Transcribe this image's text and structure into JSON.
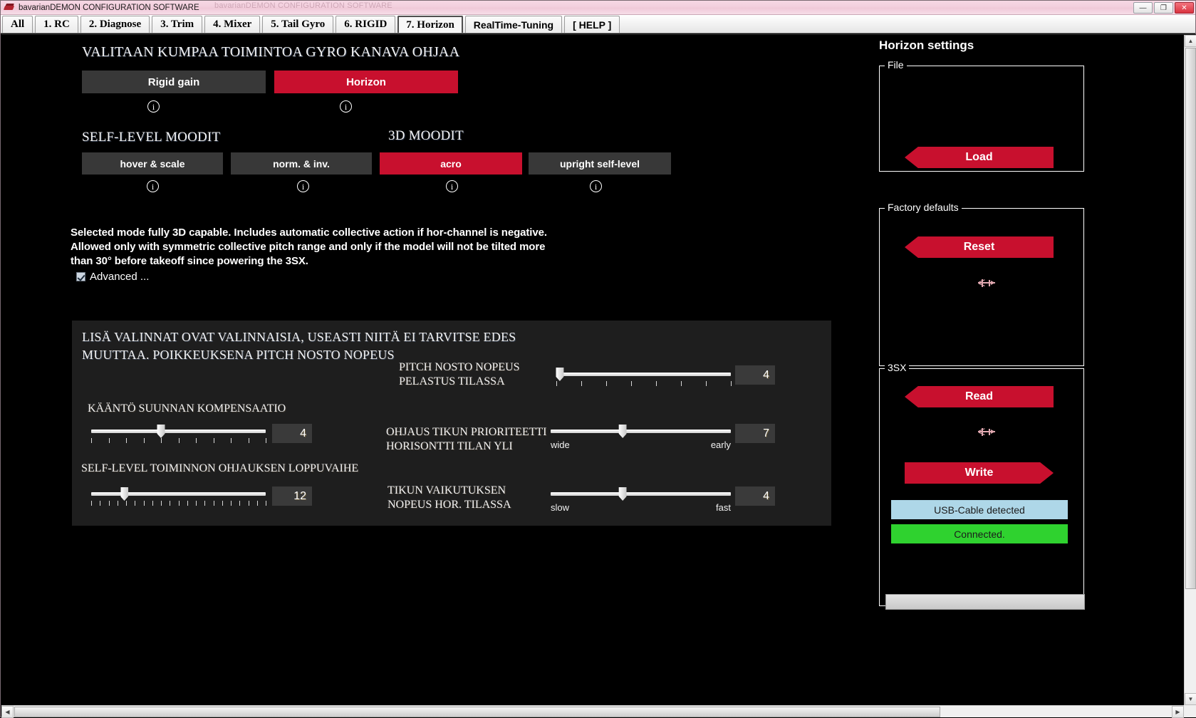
{
  "window": {
    "title": "bavarianDEMON CONFIGURATION SOFTWARE",
    "ghost_title": "bavarianDEMON CONFIGURATION SOFTWARE",
    "minimize": "—",
    "maximize": "❐",
    "close": "✕"
  },
  "tabs": [
    {
      "label": "All",
      "selected": false,
      "style": "serif"
    },
    {
      "label": "1. RC",
      "selected": false,
      "style": "serif"
    },
    {
      "label": "2. Diagnose",
      "selected": false,
      "style": "serif"
    },
    {
      "label": "3. Trim",
      "selected": false,
      "style": "serif"
    },
    {
      "label": "4. Mixer",
      "selected": false,
      "style": "serif"
    },
    {
      "label": "5. Tail Gyro",
      "selected": false,
      "style": "serif"
    },
    {
      "label": "6. RIGID",
      "selected": false,
      "style": "serif"
    },
    {
      "label": "7. Horizon",
      "selected": true,
      "style": "serif"
    },
    {
      "label": "RealTime-Tuning",
      "selected": false,
      "style": "sans"
    },
    {
      "label": "[ HELP ]",
      "selected": false,
      "style": "sans"
    }
  ],
  "main": {
    "gyro_channel_heading": "VALITAAN KUMPAA TOIMINTOA GYRO KANAVA OHJAA",
    "gyro_channel_buttons": [
      {
        "label": "Rigid gain",
        "active": false
      },
      {
        "label": "Horizon",
        "active": true
      }
    ],
    "self_level_heading": "SELF-LEVEL MOODIT",
    "mode_3d_heading": "3D MOODIT",
    "self_level_buttons": [
      {
        "label": "hover & scale",
        "active": false
      },
      {
        "label": "norm. & inv.",
        "active": false
      }
    ],
    "mode_3d_buttons": [
      {
        "label": "acro",
        "active": true
      },
      {
        "label": "upright self-level",
        "active": false
      }
    ],
    "description_lines": [
      "Selected mode fully 3D capable. Includes automatic collective action if hor-channel is negative.",
      "Allowed only with symmetric collective pitch range and only if the model will not be tilted more",
      " than 30° before takeoff since powering the 3SX."
    ],
    "advanced_checkbox_label": "Advanced ...",
    "advanced_checked": true,
    "advanced_heading_lines": [
      "LISÄ VALINNAT OVAT VALINNAISIA, USEASTI NIITÄ EI TARVITSE EDES",
      "MUUTTAA. POIKKEUKSENA PITCH NOSTO NOPEUS"
    ],
    "sliders": [
      {
        "id": "pitch-nosto-nopeus",
        "label_lines": [
          "PITCH NOSTO NOPEUS",
          "PELASTUS TILASSA"
        ],
        "value": "4",
        "percent": 2,
        "ticks": 8,
        "min_label": "",
        "max_label": ""
      },
      {
        "id": "kaanto-suunnan-kompensaatio",
        "label_lines": [
          "KÄÄNTÖ SUUNNAN KOMPENSAATIO"
        ],
        "value": "4",
        "percent": 40,
        "ticks": 11,
        "min_label": "",
        "max_label": ""
      },
      {
        "id": "ohjaus-tikun-prioriteetti",
        "label_lines": [
          "OHJAUS TIKUN PRIORITEETTI",
          "HORISONTTI TILAN YLI"
        ],
        "value": "7",
        "percent": 40,
        "ticks": 0,
        "min_label": "wide",
        "max_label": "early"
      },
      {
        "id": "self-level-toiminnon-ohjauksen-loppuvaihe",
        "label_lines": [
          "SELF-LEVEL TOIMINNON OHJAUKSEN LOPPUVAIHE"
        ],
        "value": "12",
        "percent": 19,
        "ticks": 21,
        "min_label": "",
        "max_label": ""
      },
      {
        "id": "tikun-vaikutuksen-nopeus",
        "label_lines": [
          "TIKUN VAIKUTUKSEN",
          "NOPEUS HOR. TILASSA"
        ],
        "value": "4",
        "percent": 40,
        "ticks": 0,
        "min_label": "slow",
        "max_label": "fast"
      }
    ]
  },
  "sidebar": {
    "title": "Horizon settings",
    "groups": [
      {
        "legend": "File",
        "buttons": [
          {
            "label": "Load",
            "direction": "left"
          }
        ]
      },
      {
        "legend": "Factory defaults",
        "buttons": [
          {
            "label": "Reset",
            "direction": "left"
          }
        ]
      },
      {
        "legend": "3SX",
        "buttons": [
          {
            "label": "Read",
            "direction": "left"
          },
          {
            "label": "Write",
            "direction": "right"
          }
        ],
        "status": [
          {
            "label": "USB-Cable detected",
            "kind": "usb"
          },
          {
            "label": "Connected.",
            "kind": "conn"
          }
        ]
      }
    ]
  },
  "colors": {
    "accent_red": "#c8102e",
    "panel_dark": "#1e1e1e",
    "button_grey": "#383838",
    "usb_blue": "#aed7e8",
    "connected_green": "#2fd22f"
  }
}
